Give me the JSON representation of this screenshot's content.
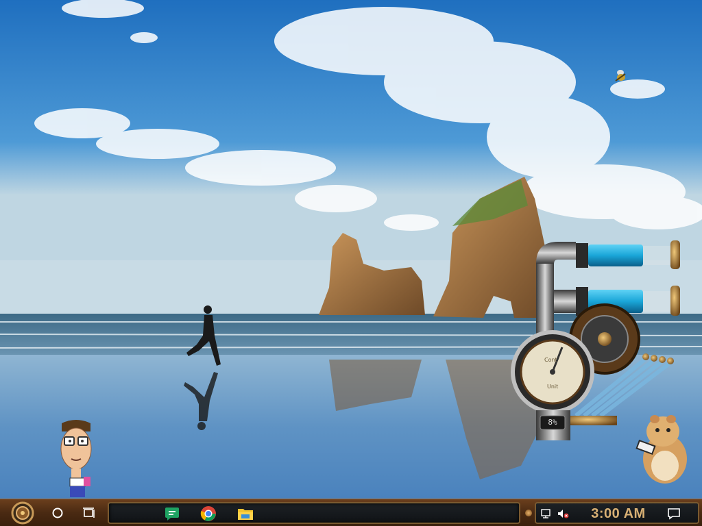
{
  "taskbar": {
    "start_icon": "steampunk-gear-icon",
    "search_icon": "circle-search-icon",
    "taskview_icon": "task-view-icon",
    "pinned_apps": [
      {
        "name": "Google Chat",
        "icon": "chat-icon",
        "color": "#1fa463"
      },
      {
        "name": "Google Chrome",
        "icon": "chrome-icon",
        "color": "#db4437"
      },
      {
        "name": "File Explorer",
        "icon": "folder-icon",
        "color": "#f4c430"
      }
    ],
    "system_tray": {
      "network_icon": "network-icon",
      "volume_icon": "volume-muted-icon",
      "clock": "3:00 AM",
      "notification_icon": "notification-icon"
    }
  },
  "desktop": {
    "wallpaper": "beach-runner-rocks",
    "gauge_widget": {
      "percent_label": "8%",
      "dial_top_text": "Cont",
      "dial_bottom_text": "Unit"
    },
    "widgets": [
      "cartoon-character",
      "hamster-reading",
      "flying-bug"
    ]
  },
  "colors": {
    "taskbar_brown": "#4a2a12",
    "clock_text": "#d8b074",
    "tray_bg": "#15191c",
    "tube_cyan": "#1aa6d8"
  }
}
